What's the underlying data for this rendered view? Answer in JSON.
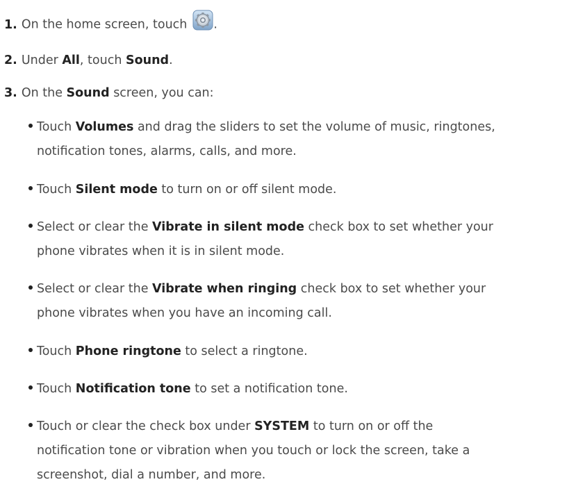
{
  "steps": [
    {
      "number": "1.",
      "pre": "On the home screen, touch",
      "post": "."
    },
    {
      "number": "2.",
      "pre": "Under ",
      "bold1": "All",
      "mid": ", touch ",
      "bold2": "Sound",
      "post": "."
    },
    {
      "number": "3.",
      "pre": "On the ",
      "bold1": "Sound",
      "post": " screen, you can:"
    }
  ],
  "settings_icon": "settings-gear-icon",
  "bullets": [
    {
      "pre": "Touch ",
      "bold": "Volumes",
      "post": " and drag the sliders to set the volume of music, ringtones,",
      "cont": "notification tones, alarms, calls, and more."
    },
    {
      "pre": "Touch ",
      "bold": "Silent mode",
      "post": " to turn on or off silent mode."
    },
    {
      "pre": "Select or clear the ",
      "bold": "Vibrate in silent mode",
      "post": " check box to set whether your",
      "cont": "phone vibrates when it is in silent mode."
    },
    {
      "pre": "Select or clear the ",
      "bold": "Vibrate when ringing",
      "post": " check box to set whether your",
      "cont": "phone vibrates when you have an incoming call."
    },
    {
      "pre": "Touch ",
      "bold": "Phone ringtone",
      "post": " to select a ringtone."
    },
    {
      "pre": "Touch ",
      "bold": "Notification tone",
      "post": " to set a notification tone."
    },
    {
      "pre": "Touch or clear the check box under ",
      "bold": "SYSTEM",
      "post": " to turn on or off the",
      "cont": "notification tone or vibration when you touch or lock the screen, take a",
      "cont2": "screenshot, dial a number, and more."
    }
  ]
}
